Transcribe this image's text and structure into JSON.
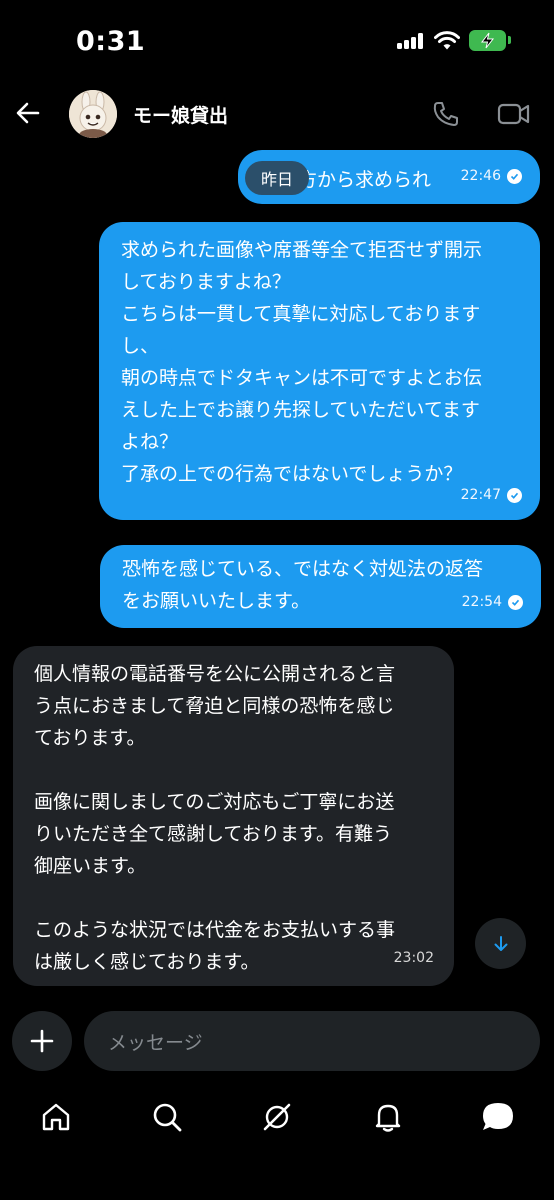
{
  "status_bar": {
    "time": "0:31"
  },
  "header": {
    "contact_name": "モー娘貸出"
  },
  "day_label": "昨日",
  "messages": [
    {
      "direction": "out",
      "text": "方から求められ",
      "time": "22:46"
    },
    {
      "direction": "out",
      "text": "求められた画像や席番等全て拒否せず開示\nしておりますよね？\nこちらは一貫して真摯に対応しております\nし、\n朝の時点でドタキャンは不可ですよとお伝\nえした上でお譲り先探していただいてます\nよね？\n了承の上での行為ではないでしょうか？",
      "time": "22:47"
    },
    {
      "direction": "out",
      "text": "恐怖を感じている、ではなく対処法の返答\nをお願いいたします。",
      "time": "22:54"
    },
    {
      "direction": "in",
      "text": "個人情報の電話番号を公に公開されると言\nう点におきまして脅迫と同様の恐怖を感じ\nております。\n\n画像に関しましてのご対応もご丁寧にお送\nりいただき全て感謝しております。有難う\n御座います。\n\nこのような状況では代金をお支払いする事\nは厳しく感じております。",
      "time": "23:02"
    }
  ],
  "composer": {
    "placeholder": "メッセージ"
  },
  "colors": {
    "accent": "#1d9bf0",
    "incoming_bubble": "#202327",
    "background": "#000000",
    "battery": "#3fb950"
  },
  "icons": [
    "back-arrow-icon",
    "call-icon",
    "video-icon",
    "scroll-down-icon",
    "add-icon",
    "home-icon",
    "search-icon",
    "grok-icon",
    "notifications-icon",
    "messages-icon"
  ]
}
